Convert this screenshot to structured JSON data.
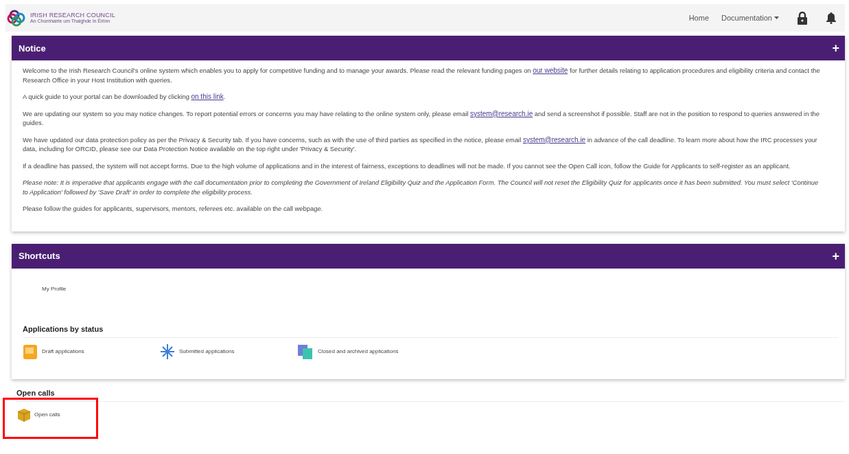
{
  "header": {
    "logo_title": "IRISH RESEARCH COUNCIL",
    "logo_subtitle": "An Chomhairle um Thaighde in Éirinn",
    "nav": [
      {
        "label": "Home",
        "dropdown": false
      },
      {
        "label": "Documentation",
        "dropdown": true
      }
    ]
  },
  "notice": {
    "title": "Notice",
    "expand": "+",
    "paragraphs": [
      [
        {
          "text": "Welcome to the Irish Research Council's online system which enables you to apply for competitive funding and to manage your awards. Please read the relevant funding pages on "
        },
        {
          "link": "our website"
        },
        {
          "text": " for further details relating to application procedures and eligibility criteria and contact the Research Office in your Host Institution with queries."
        }
      ],
      [
        {
          "text": "A quick guide to your portal can be downloaded by clicking "
        },
        {
          "link": "on this link"
        },
        {
          "text": "."
        }
      ],
      [
        {
          "text": "We are updating our system so you may notice changes. To report potential errors or concerns you may have relating to the online system only, please email "
        },
        {
          "link": "system@research.ie"
        },
        {
          "text": " and send a screenshot if possible. Staff are not in the position to respond to queries answered in the guides."
        }
      ],
      [
        {
          "text": "We have updated our data protection policy as per the Privacy & Security tab. If you have concerns, such as with the use of third parties as specified in the notice, please email "
        },
        {
          "link": "system@research.ie"
        },
        {
          "text": " in advance of the call deadline. To learn more about how the IRC processes your data, including for ORCID, please see our Data Protection Notice available on the top right under 'Privacy & Security'."
        }
      ],
      [
        {
          "text": "If a deadline has passed, the system will not accept forms. Due to the high volume of applications and in the interest of fairness, exceptions to deadlines will not be made. If you cannot see the Open Call icon, follow the Guide for Applicants to self-register as an applicant."
        }
      ],
      [
        {
          "text": "*Please note: It is imperative that applicants engage with the call documentation prior to completing the Government of Ireland Eligibility Quiz and the Application Form. The Council will not reset the Eligibility Quiz for applicants once it has been submitted. You must select 'Continue to Application' followed by 'Save Draft' in order to complete the eligibility process.*"
        }
      ],
      [
        {
          "text": "Please follow the guides for applicants, supervisors, mentors, referees etc. available on the call webpage."
        }
      ]
    ]
  },
  "shortcuts": {
    "title": "Shortcuts",
    "expand": "+",
    "links": [
      "My Profile"
    ],
    "status_heading": "Applications by status",
    "status_items": [
      {
        "kind": "draft",
        "label": "Draft applications"
      },
      {
        "kind": "submitted",
        "label": "Submitted applications"
      },
      {
        "kind": "closed",
        "label": "Closed and archived applications"
      }
    ]
  },
  "open_calls": {
    "heading": "Open calls",
    "items": [
      {
        "kind": "box",
        "label": "Open calls",
        "highlighted": true
      }
    ]
  }
}
